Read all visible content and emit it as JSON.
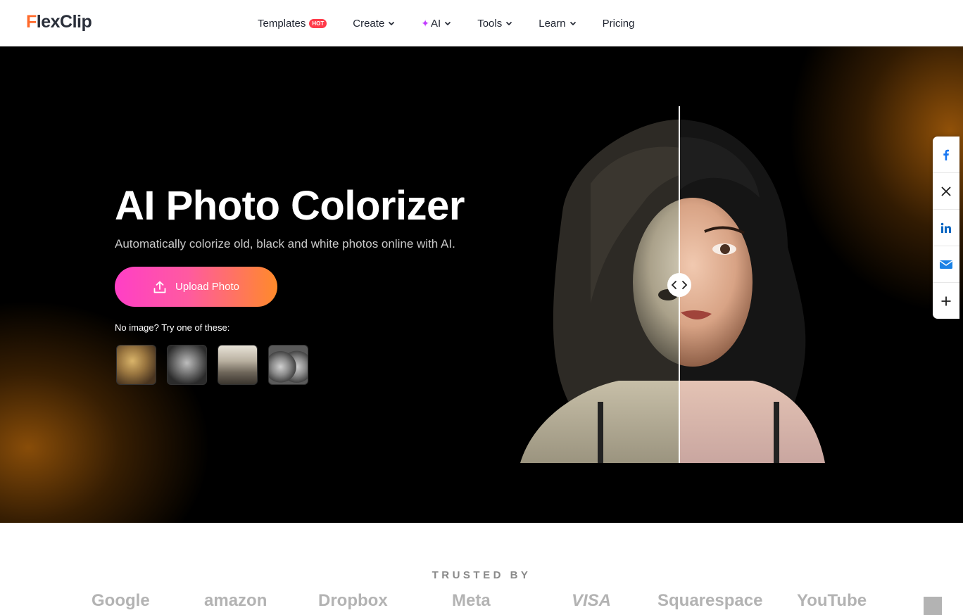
{
  "header": {
    "logo_text_accent": "F",
    "logo_text_rest": "lexClip",
    "nav": [
      {
        "label": "Templates",
        "badge": "HOT"
      },
      {
        "label": "Create"
      },
      {
        "label": "AI"
      },
      {
        "label": "Tools"
      },
      {
        "label": "Learn"
      },
      {
        "label": "Pricing"
      }
    ]
  },
  "hero": {
    "title": "AI Photo Colorizer",
    "subtitle": "Automatically colorize old, black and white photos online with AI.",
    "upload_label": "Upload Photo",
    "sample_label": "No image? Try one of these:"
  },
  "social": {
    "icons": [
      "facebook-icon",
      "x-icon",
      "linkedin-icon",
      "email-icon",
      "plus-icon"
    ]
  },
  "trusted": {
    "label": "TRUSTED BY",
    "brands": [
      "Google",
      "amazon",
      "Dropbox",
      "Meta",
      "VISA",
      "Squarespace",
      "YouTube"
    ]
  },
  "colors": {
    "accent_orange": "#ff6a2b",
    "hot_badge": "#ff3b4a",
    "button_gradient_start": "#ff3fc6",
    "button_gradient_end": "#ff8a2a",
    "facebook": "#1877f2",
    "linkedin": "#0a66c2"
  }
}
